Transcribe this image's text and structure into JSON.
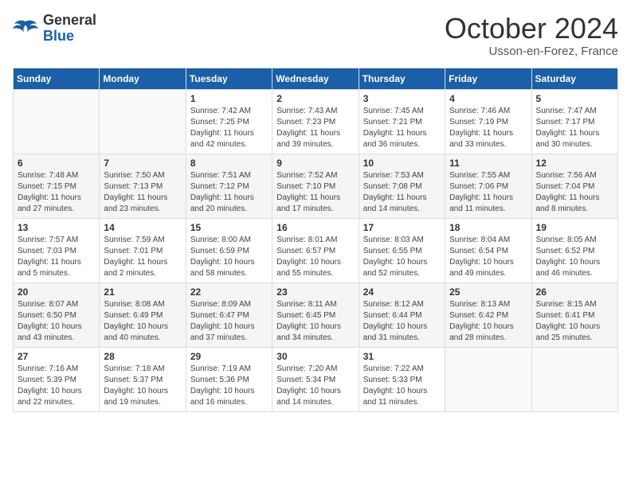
{
  "header": {
    "logo_general": "General",
    "logo_blue": "Blue",
    "month_title": "October 2024",
    "subtitle": "Usson-en-Forez, France"
  },
  "days_of_week": [
    "Sunday",
    "Monday",
    "Tuesday",
    "Wednesday",
    "Thursday",
    "Friday",
    "Saturday"
  ],
  "weeks": [
    [
      {
        "num": "",
        "info": ""
      },
      {
        "num": "",
        "info": ""
      },
      {
        "num": "1",
        "info": "Sunrise: 7:42 AM\nSunset: 7:25 PM\nDaylight: 11 hours and 42 minutes."
      },
      {
        "num": "2",
        "info": "Sunrise: 7:43 AM\nSunset: 7:23 PM\nDaylight: 11 hours and 39 minutes."
      },
      {
        "num": "3",
        "info": "Sunrise: 7:45 AM\nSunset: 7:21 PM\nDaylight: 11 hours and 36 minutes."
      },
      {
        "num": "4",
        "info": "Sunrise: 7:46 AM\nSunset: 7:19 PM\nDaylight: 11 hours and 33 minutes."
      },
      {
        "num": "5",
        "info": "Sunrise: 7:47 AM\nSunset: 7:17 PM\nDaylight: 11 hours and 30 minutes."
      }
    ],
    [
      {
        "num": "6",
        "info": "Sunrise: 7:48 AM\nSunset: 7:15 PM\nDaylight: 11 hours and 27 minutes."
      },
      {
        "num": "7",
        "info": "Sunrise: 7:50 AM\nSunset: 7:13 PM\nDaylight: 11 hours and 23 minutes."
      },
      {
        "num": "8",
        "info": "Sunrise: 7:51 AM\nSunset: 7:12 PM\nDaylight: 11 hours and 20 minutes."
      },
      {
        "num": "9",
        "info": "Sunrise: 7:52 AM\nSunset: 7:10 PM\nDaylight: 11 hours and 17 minutes."
      },
      {
        "num": "10",
        "info": "Sunrise: 7:53 AM\nSunset: 7:08 PM\nDaylight: 11 hours and 14 minutes."
      },
      {
        "num": "11",
        "info": "Sunrise: 7:55 AM\nSunset: 7:06 PM\nDaylight: 11 hours and 11 minutes."
      },
      {
        "num": "12",
        "info": "Sunrise: 7:56 AM\nSunset: 7:04 PM\nDaylight: 11 hours and 8 minutes."
      }
    ],
    [
      {
        "num": "13",
        "info": "Sunrise: 7:57 AM\nSunset: 7:03 PM\nDaylight: 11 hours and 5 minutes."
      },
      {
        "num": "14",
        "info": "Sunrise: 7:59 AM\nSunset: 7:01 PM\nDaylight: 11 hours and 2 minutes."
      },
      {
        "num": "15",
        "info": "Sunrise: 8:00 AM\nSunset: 6:59 PM\nDaylight: 10 hours and 58 minutes."
      },
      {
        "num": "16",
        "info": "Sunrise: 8:01 AM\nSunset: 6:57 PM\nDaylight: 10 hours and 55 minutes."
      },
      {
        "num": "17",
        "info": "Sunrise: 8:03 AM\nSunset: 6:55 PM\nDaylight: 10 hours and 52 minutes."
      },
      {
        "num": "18",
        "info": "Sunrise: 8:04 AM\nSunset: 6:54 PM\nDaylight: 10 hours and 49 minutes."
      },
      {
        "num": "19",
        "info": "Sunrise: 8:05 AM\nSunset: 6:52 PM\nDaylight: 10 hours and 46 minutes."
      }
    ],
    [
      {
        "num": "20",
        "info": "Sunrise: 8:07 AM\nSunset: 6:50 PM\nDaylight: 10 hours and 43 minutes."
      },
      {
        "num": "21",
        "info": "Sunrise: 8:08 AM\nSunset: 6:49 PM\nDaylight: 10 hours and 40 minutes."
      },
      {
        "num": "22",
        "info": "Sunrise: 8:09 AM\nSunset: 6:47 PM\nDaylight: 10 hours and 37 minutes."
      },
      {
        "num": "23",
        "info": "Sunrise: 8:11 AM\nSunset: 6:45 PM\nDaylight: 10 hours and 34 minutes."
      },
      {
        "num": "24",
        "info": "Sunrise: 8:12 AM\nSunset: 6:44 PM\nDaylight: 10 hours and 31 minutes."
      },
      {
        "num": "25",
        "info": "Sunrise: 8:13 AM\nSunset: 6:42 PM\nDaylight: 10 hours and 28 minutes."
      },
      {
        "num": "26",
        "info": "Sunrise: 8:15 AM\nSunset: 6:41 PM\nDaylight: 10 hours and 25 minutes."
      }
    ],
    [
      {
        "num": "27",
        "info": "Sunrise: 7:16 AM\nSunset: 5:39 PM\nDaylight: 10 hours and 22 minutes."
      },
      {
        "num": "28",
        "info": "Sunrise: 7:18 AM\nSunset: 5:37 PM\nDaylight: 10 hours and 19 minutes."
      },
      {
        "num": "29",
        "info": "Sunrise: 7:19 AM\nSunset: 5:36 PM\nDaylight: 10 hours and 16 minutes."
      },
      {
        "num": "30",
        "info": "Sunrise: 7:20 AM\nSunset: 5:34 PM\nDaylight: 10 hours and 14 minutes."
      },
      {
        "num": "31",
        "info": "Sunrise: 7:22 AM\nSunset: 5:33 PM\nDaylight: 10 hours and 11 minutes."
      },
      {
        "num": "",
        "info": ""
      },
      {
        "num": "",
        "info": ""
      }
    ]
  ]
}
